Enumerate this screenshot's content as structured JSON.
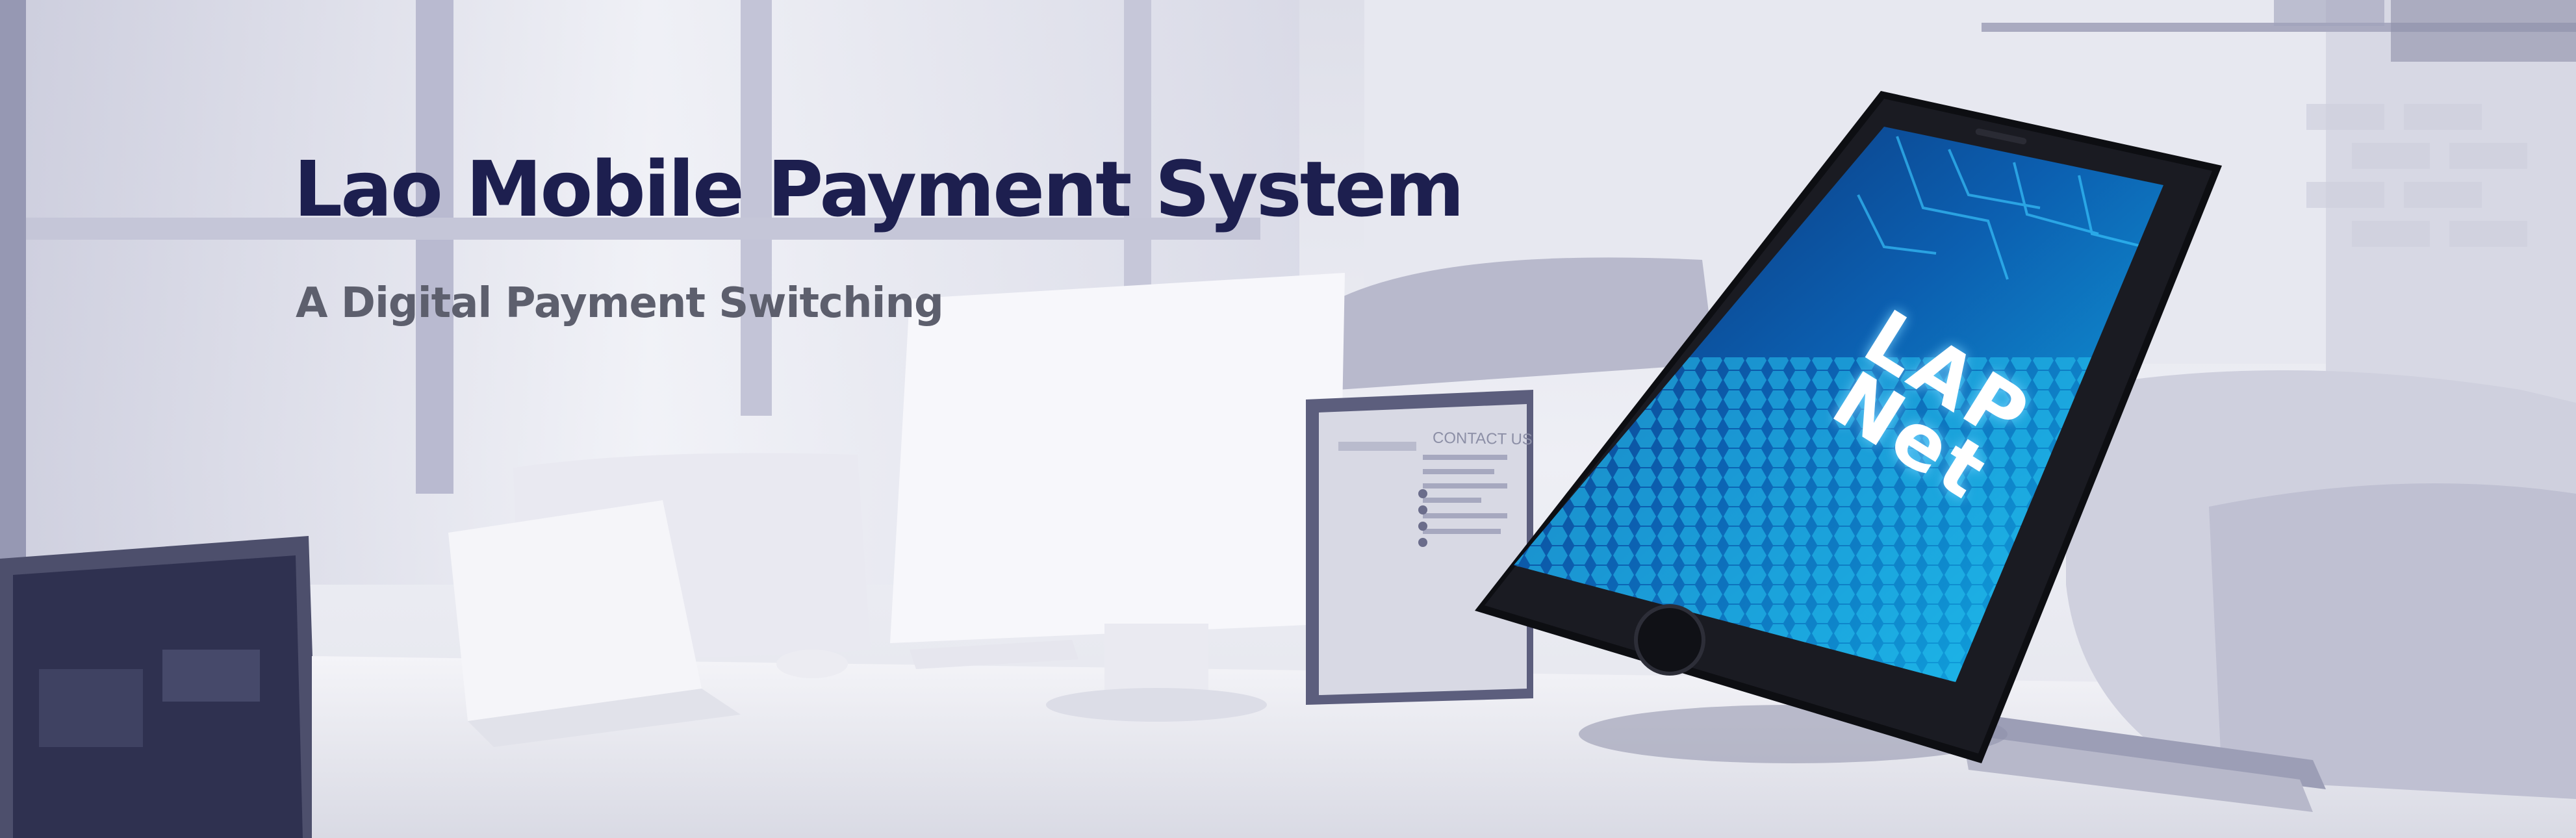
{
  "banner": {
    "title": "Lao Mobile Payment System",
    "subtitle": "A Digital Payment Switching"
  },
  "monitor": {
    "heading": "CONTACT US"
  },
  "phone": {
    "logo_line1": "LAP",
    "logo_line2": "Net"
  },
  "colors": {
    "title": "#1d1f4f",
    "subtitle": "#5d5f6d",
    "screen_accent": "#1aa9e6"
  }
}
